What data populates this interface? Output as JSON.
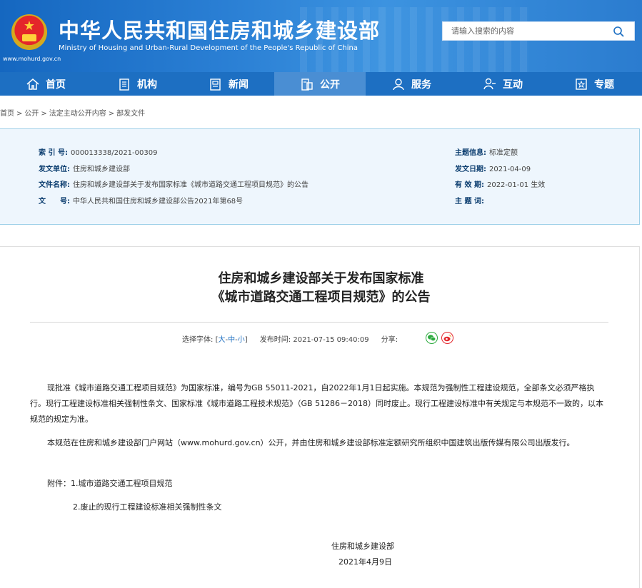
{
  "header": {
    "title_cn": "中华人民共和国住房和城乡建设部",
    "title_en": "Ministry of Housing and Urban-Rural Development of the People's Republic of China",
    "site_url": "www.mohurd.gov.cn",
    "search_placeholder": "请输入搜索的内容"
  },
  "nav": [
    {
      "label": "首页",
      "icon": "home-icon"
    },
    {
      "label": "机构",
      "icon": "building-icon"
    },
    {
      "label": "新闻",
      "icon": "news-icon"
    },
    {
      "label": "公开",
      "icon": "public-icon",
      "active": true
    },
    {
      "label": "服务",
      "icon": "service-icon"
    },
    {
      "label": "互动",
      "icon": "interact-icon"
    },
    {
      "label": "专题",
      "icon": "topic-icon"
    }
  ],
  "breadcrumb": [
    "首页",
    "公开",
    "法定主动公开内容",
    "部发文件"
  ],
  "info": {
    "index_label": "索 引 号:",
    "index_value": "000013338/2021-00309",
    "unit_label": "发文单位:",
    "unit_value": "住房和城乡建设部",
    "name_label": "文件名称:",
    "name_value": "住房和城乡建设部关于发布国家标准《城市道路交通工程项目规范》的公告",
    "doc_label": "文　　号:",
    "doc_value": "中华人民共和国住房和城乡建设部公告2021年第68号",
    "topic_label": "主题信息:",
    "topic_value": "标准定额",
    "date_label": "发文日期:",
    "date_value": "2021-04-09",
    "valid_label": "有 效 期:",
    "valid_value": "2022-01-01 生效",
    "keyword_label": "主 题 词:",
    "keyword_value": ""
  },
  "article": {
    "title_line1": "住房和城乡建设部关于发布国家标准",
    "title_line2": "《城市道路交通工程项目规范》的公告",
    "font_label": "选择字体:",
    "font_large": "大",
    "font_medium": "中",
    "font_small": "小",
    "publish_label": "发布时间:",
    "publish_time": "2021-07-15 09:40:09",
    "share_label": "分享:",
    "para1": "现批准《城市道路交通工程项目规范》为国家标准，编号为GB 55011-2021，自2022年1月1日起实施。本规范为强制性工程建设规范，全部条文必须严格执行。现行工程建设标准相关强制性条文、国家标准《城市道路工程技术规范》（GB 51286－2018）同时废止。现行工程建设标准中有关规定与本规范不一致的，以本规范的规定为准。",
    "para2": "本规范在住房和城乡建设部门户网站（www.mohurd.gov.cn）公开，并由住房和城乡建设部标准定额研究所组织中国建筑出版传媒有限公司出版发行。",
    "attach1": "附件：1.城市道路交通工程项目规范",
    "attach2": "2.废止的现行工程建设标准相关强制性条文",
    "signer": "住房和城乡建设部",
    "sign_date": "2021年4月9日"
  },
  "colors": {
    "header_blue": "#1d6fc2",
    "nav_active": "#4a8ed3",
    "info_bg": "#eef6fd",
    "info_border": "#9fd0e8",
    "label_blue": "#0b3d6f"
  }
}
